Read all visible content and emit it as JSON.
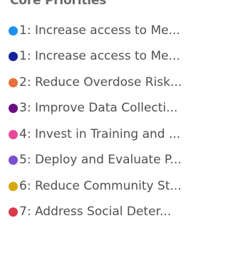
{
  "legend": {
    "title": "Core Priorities",
    "items": [
      {
        "label": "1: Increase access to Me...",
        "color": "#1e90ef"
      },
      {
        "label": "1: Increase access to Me...",
        "color": "#15239a"
      },
      {
        "label": "2: Reduce Overdose Risk...",
        "color": "#e8703d"
      },
      {
        "label": "3: Improve Data Collecti...",
        "color": "#6b0b82"
      },
      {
        "label": "4: Invest in Training and ...",
        "color": "#e8489a"
      },
      {
        "label": "5: Deploy and Evaluate P...",
        "color": "#7b4fcf"
      },
      {
        "label": "6: Reduce Community St...",
        "color": "#d6a90f"
      },
      {
        "label": "7: Address Social Deter...",
        "color": "#d83a4c"
      }
    ]
  }
}
